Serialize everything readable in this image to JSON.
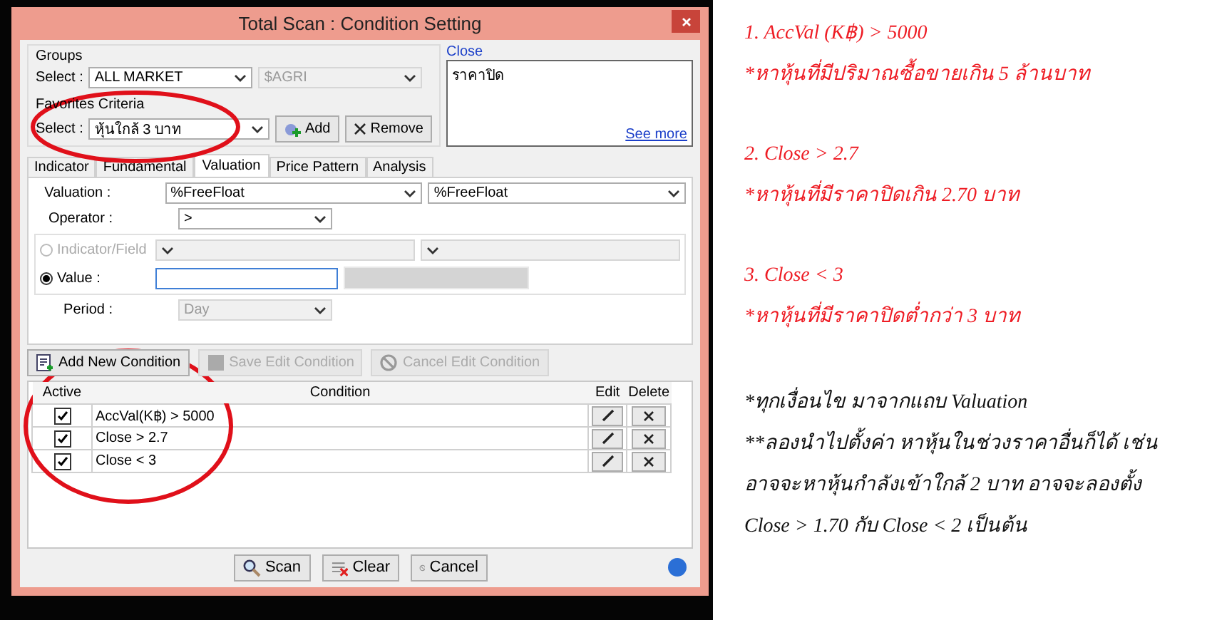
{
  "dialog": {
    "title": "Total Scan : Condition Setting",
    "groups": {
      "label": "Groups",
      "select_label": "Select :",
      "group": "ALL MARKET",
      "subgroup": "$AGRI"
    },
    "favorites": {
      "label": "Favorites Criteria",
      "select_label": "Select :",
      "value": "หุ้นใกล้ 3 บาท",
      "add": "Add",
      "remove": "Remove",
      "highlighted": true
    },
    "description": {
      "title": "Close",
      "text": "ราคาปิด",
      "link": "See more"
    },
    "tabs": [
      {
        "label": "Indicator",
        "selected": false
      },
      {
        "label": "Fundamental",
        "selected": false
      },
      {
        "label": "Valuation",
        "selected": true
      },
      {
        "label": "Price Pattern",
        "selected": false
      },
      {
        "label": "Analysis",
        "selected": false
      }
    ],
    "form": {
      "valuation_label": "Valuation :",
      "valuation": [
        "%FreeFloat",
        "%FreeFloat"
      ],
      "operator_label": "Operator :",
      "operator": ">",
      "sources": [
        {
          "label": "Indicator/Field",
          "selected": false,
          "disabled": true
        },
        {
          "label": "Value :",
          "selected": true,
          "disabled": false
        }
      ],
      "period_label": "Period :",
      "period": "Day"
    },
    "toolbar": [
      {
        "label": "Add New Condition",
        "kind": "add",
        "disabled": false
      },
      {
        "label": "Save Edit Condition",
        "kind": "save",
        "disabled": true
      },
      {
        "label": "Cancel Edit Condition",
        "kind": "cancel",
        "disabled": true
      }
    ],
    "table": {
      "columns": [
        "Active",
        "Condition",
        "Edit",
        "Delete"
      ],
      "highlighted": true,
      "rows": [
        {
          "active": true,
          "condition": "AccVal(K฿) > 5000"
        },
        {
          "active": true,
          "condition": "Close > 2.7"
        },
        {
          "active": true,
          "condition": "Close < 3"
        }
      ]
    },
    "buttons": [
      {
        "label": "Scan",
        "kind": "scan"
      },
      {
        "label": "Clear",
        "kind": "clear"
      },
      {
        "label": "Cancel",
        "kind": "cancel"
      }
    ]
  },
  "steps": [
    {
      "condition": "1. AccVal (K฿) > 5000",
      "explanation": "*หาหุ้นที่มีปริมาณซื้อขายเกิน 5 ล้านบาท"
    },
    {
      "condition": "2. Close > 2.7",
      "explanation": "*หาหุ้นที่มีราคาปิดเกิน 2.70 บาท"
    },
    {
      "condition": "3. Close < 3",
      "explanation": "*หาหุ้นที่มีราคาปิดต่ำกว่า 3 บาท"
    }
  ],
  "remarks": [
    "*ทุกเงื่อนไข มาจากแถบ Valuation",
    "**ลองนำไปตั้งค่า หาหุ้นในช่วงราคาอื่นก็ได้ เช่น อาจจะหาหุ้นกำลังเข้าใกล้ 2 บาท อาจจะลองตั้ง Close > 1.70 กับ Close < 2 เป็นต้น"
  ]
}
